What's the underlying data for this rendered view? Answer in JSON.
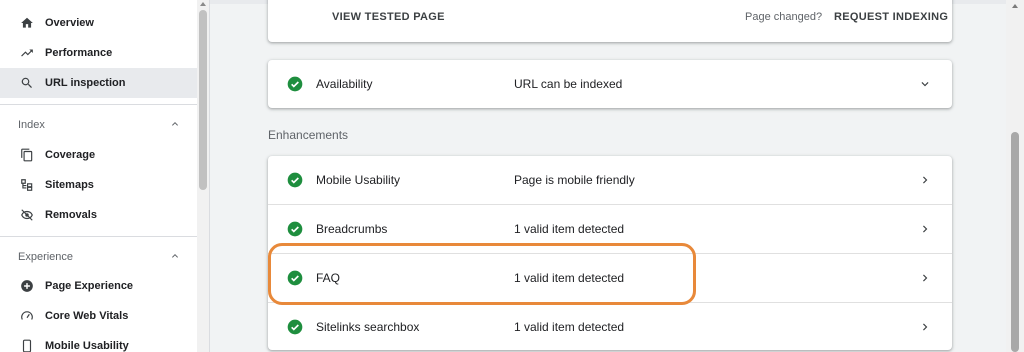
{
  "sidebar": {
    "items": [
      {
        "label": "Overview",
        "icon": "home-icon"
      },
      {
        "label": "Performance",
        "icon": "trending-up-icon"
      },
      {
        "label": "URL inspection",
        "icon": "search-icon"
      }
    ],
    "index_section": {
      "title": "Index",
      "items": [
        {
          "label": "Coverage",
          "icon": "copy-icon"
        },
        {
          "label": "Sitemaps",
          "icon": "sitemap-icon"
        },
        {
          "label": "Removals",
          "icon": "eye-off-icon"
        }
      ]
    },
    "experience_section": {
      "title": "Experience",
      "items": [
        {
          "label": "Page Experience",
          "icon": "plus-circle-icon"
        },
        {
          "label": "Core Web Vitals",
          "icon": "speedometer-icon"
        },
        {
          "label": "Mobile Usability",
          "icon": "phone-icon"
        }
      ]
    },
    "active_item": "URL inspection"
  },
  "top_card": {
    "view_tested_page": "VIEW TESTED PAGE",
    "page_changed": "Page changed?",
    "request_indexing": "REQUEST INDEXING"
  },
  "availability": {
    "name": "Availability",
    "status": "URL can be indexed"
  },
  "enhancements": {
    "title": "Enhancements",
    "rows": [
      {
        "name": "Mobile Usability",
        "status": "Page is mobile friendly"
      },
      {
        "name": "Breadcrumbs",
        "status": "1 valid item detected"
      },
      {
        "name": "FAQ",
        "status": "1 valid item detected"
      },
      {
        "name": "Sitelinks searchbox",
        "status": "1 valid item detected"
      }
    ]
  },
  "colors": {
    "check_green": "#1e8e3e",
    "highlight": "#e8893a",
    "active_bg": "#e8eaed"
  }
}
